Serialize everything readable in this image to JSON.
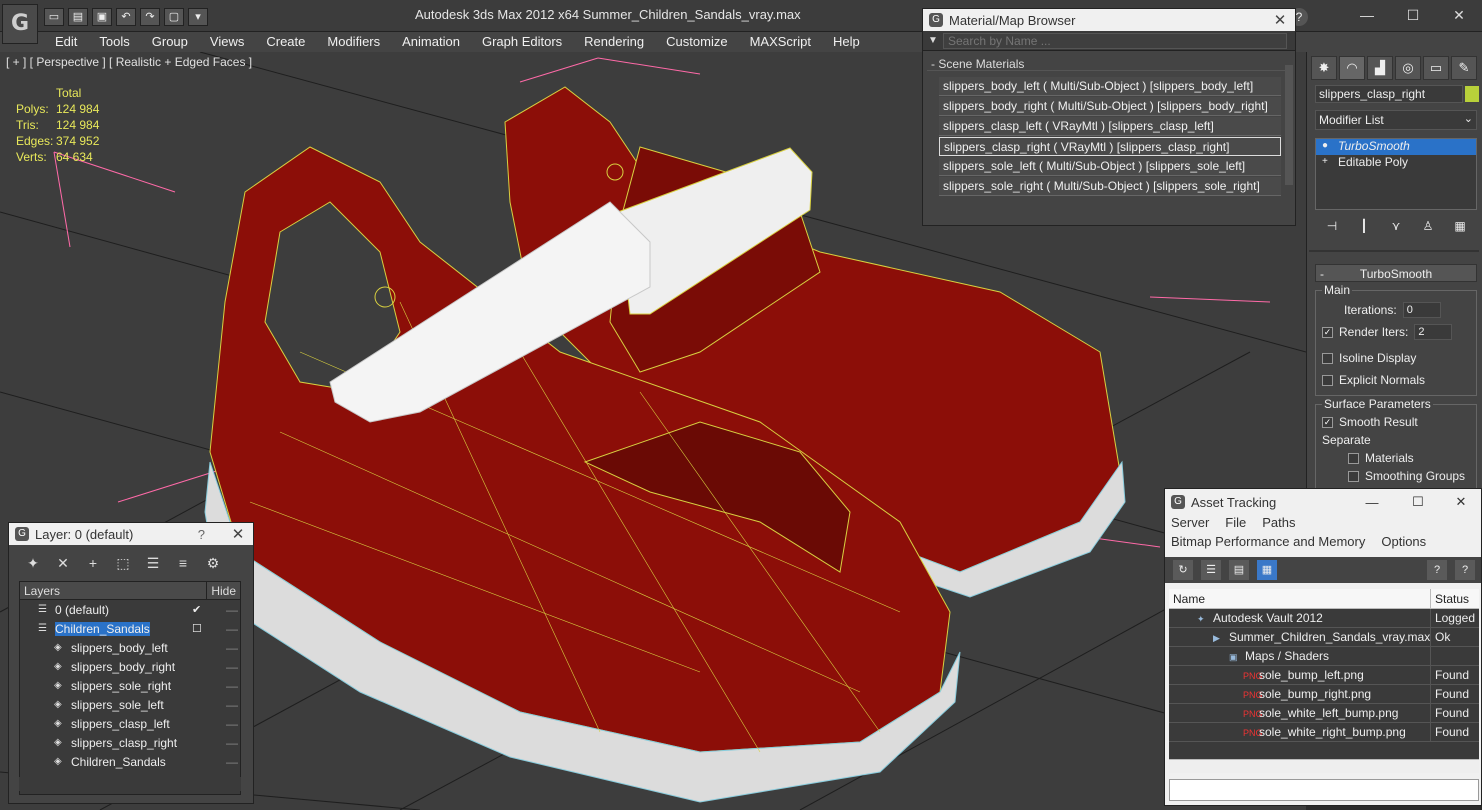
{
  "app": {
    "logo_glyph": "G",
    "window_title": "Autodesk 3ds Max  2012 x64      Summer_Children_Sandals_vray.max",
    "help_glyph": "?",
    "window_controls": [
      "—",
      "☐",
      "✕"
    ]
  },
  "menubar": [
    "Edit",
    "Tools",
    "Group",
    "Views",
    "Create",
    "Modifiers",
    "Animation",
    "Graph Editors",
    "Rendering",
    "Customize",
    "MAXScript",
    "Help"
  ],
  "viewport": {
    "label": "[ + ] [ Perspective ] [ Realistic + Edged Faces ]",
    "stats": {
      "header": "Total",
      "rows": [
        {
          "label": "Polys:",
          "value": "124 984"
        },
        {
          "label": "Tris:",
          "value": "124 984"
        },
        {
          "label": "Edges:",
          "value": "374 952"
        },
        {
          "label": "Verts:",
          "value": "64 634"
        }
      ]
    },
    "colors": {
      "background": "#3d3d3d",
      "grid": "#1e1e1e",
      "sandal_red": "#8c0e08",
      "wire": "#d8d040",
      "sole": "#dcdcdc",
      "strap": "#f2f2f2"
    }
  },
  "material_browser": {
    "title": "Material/Map Browser",
    "search_placeholder": "Search by Name ...",
    "group": "- Scene Materials",
    "items": [
      "slippers_body_left ( Multi/Sub-Object ) [slippers_body_left]",
      "slippers_body_right ( Multi/Sub-Object ) [slippers_body_right]",
      "slippers_clasp_left ( VRayMtl ) [slippers_clasp_left]",
      "slippers_clasp_right ( VRayMtl ) [slippers_clasp_right]",
      "slippers_sole_left ( Multi/Sub-Object ) [slippers_sole_left]",
      "slippers_sole_right ( Multi/Sub-Object ) [slippers_sole_right]"
    ],
    "selected_index": 3
  },
  "command_panel": {
    "object_name": "slippers_clasp_right",
    "object_color": "#b8d03a",
    "modifier_list": "Modifier List",
    "stack": [
      "TurboSmooth",
      "Editable Poly"
    ],
    "turbosmooth": {
      "title": "TurboSmooth",
      "main_label": "Main",
      "iterations_label": "Iterations:",
      "iterations_value": "0",
      "render_iters_label": "Render Iters:",
      "render_iters_value": "2",
      "isoline": "Isoline Display",
      "explicit_normals": "Explicit Normals",
      "surface_label": "Surface Parameters",
      "smooth_result": "Smooth Result",
      "separate_label": "Separate",
      "materials": "Materials",
      "smoothing_groups": "Smoothing Groups"
    }
  },
  "layer_window": {
    "title": "Layer: 0 (default)",
    "help": "?",
    "columns": [
      "Layers",
      "Hide"
    ],
    "rows": [
      {
        "name": "0 (default)",
        "indent": 1,
        "checked": true,
        "selected": false
      },
      {
        "name": "Children_Sandals",
        "indent": 1,
        "checked": false,
        "selected": true,
        "box": true
      },
      {
        "name": "slippers_body_left",
        "indent": 2
      },
      {
        "name": "slippers_body_right",
        "indent": 2
      },
      {
        "name": "slippers_sole_right",
        "indent": 2
      },
      {
        "name": "slippers_sole_left",
        "indent": 2
      },
      {
        "name": "slippers_clasp_left",
        "indent": 2
      },
      {
        "name": "slippers_clasp_right",
        "indent": 2
      },
      {
        "name": "Children_Sandals",
        "indent": 2
      }
    ]
  },
  "asset_tracking": {
    "title": "Asset Tracking",
    "menu1": [
      "Server",
      "File",
      "Paths"
    ],
    "menu2": [
      "Bitmap Performance and Memory",
      "Options"
    ],
    "columns": [
      "Name",
      "Status"
    ],
    "rows": [
      {
        "name": "Autodesk Vault 2012",
        "status": "Logged",
        "indent": 28,
        "icon": "✦"
      },
      {
        "name": "Summer_Children_Sandals_vray.max",
        "status": "Ok",
        "indent": 44,
        "icon": "▶"
      },
      {
        "name": "Maps / Shaders",
        "status": "",
        "indent": 60,
        "icon": "▣"
      },
      {
        "name": "sole_bump_left.png",
        "status": "Found",
        "indent": 74,
        "icon": "PNG"
      },
      {
        "name": "sole_bump_right.png",
        "status": "Found",
        "indent": 74,
        "icon": "PNG"
      },
      {
        "name": "sole_white_left_bump.png",
        "status": "Found",
        "indent": 74,
        "icon": "PNG"
      },
      {
        "name": "sole_white_right_bump.png",
        "status": "Found",
        "indent": 74,
        "icon": "PNG"
      }
    ]
  }
}
